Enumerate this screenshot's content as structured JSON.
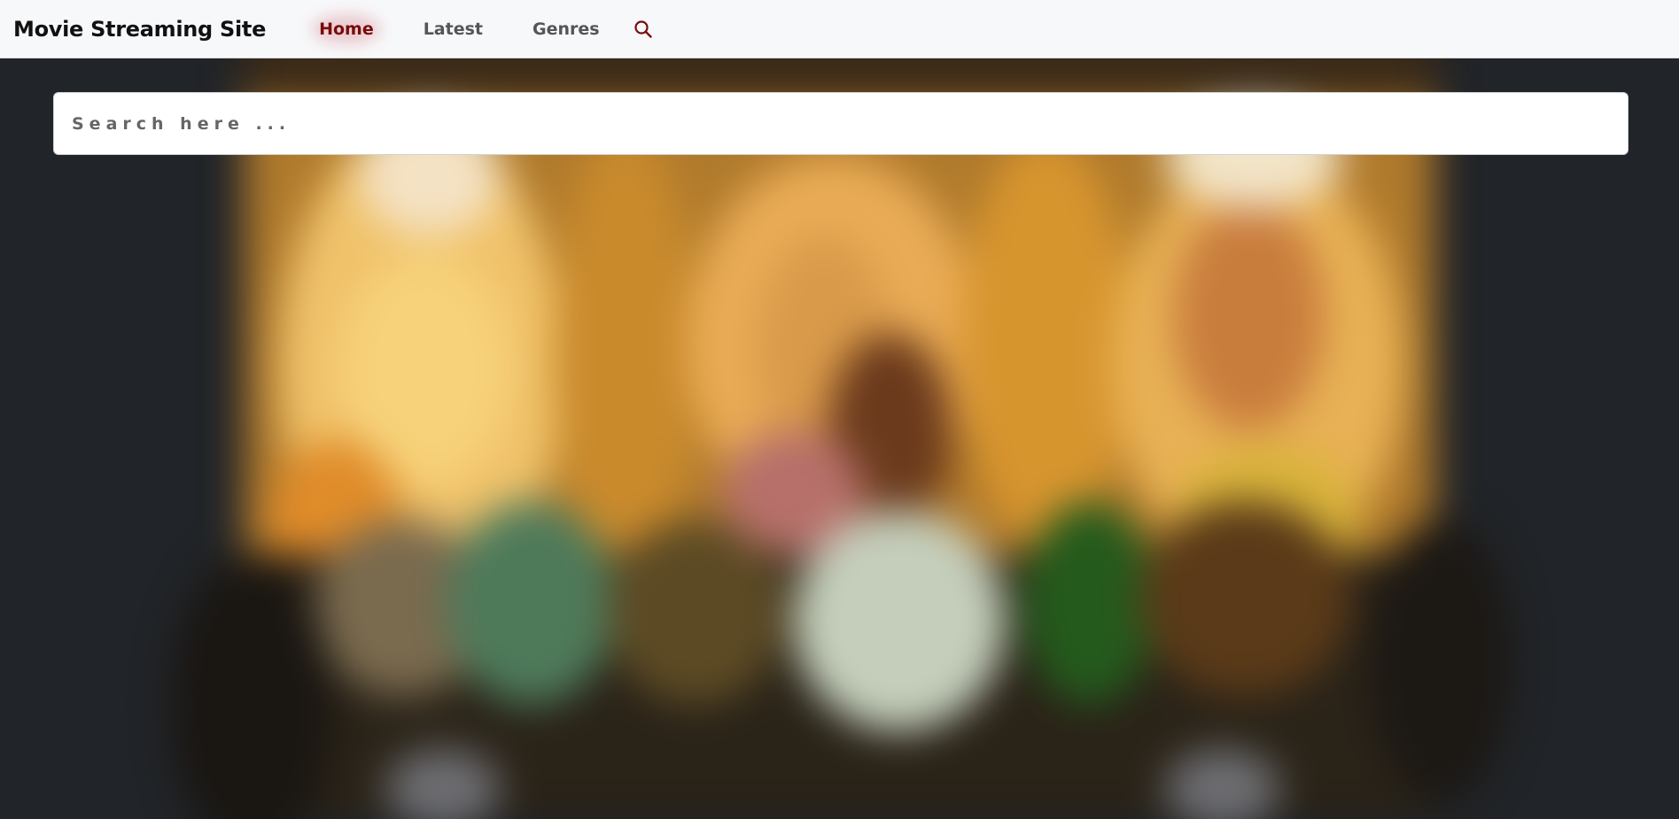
{
  "header": {
    "brand": "Movie Streaming Site",
    "nav": [
      {
        "label": "Home",
        "active": true
      },
      {
        "label": "Latest",
        "active": false
      },
      {
        "label": "Genres",
        "active": false
      }
    ],
    "search_icon": "search-icon",
    "accent_color": "#7a0a0a"
  },
  "search": {
    "placeholder": "Search here ...",
    "value": ""
  },
  "hero": {
    "image": "blurred-movie-poster",
    "background_color": "#212428"
  }
}
